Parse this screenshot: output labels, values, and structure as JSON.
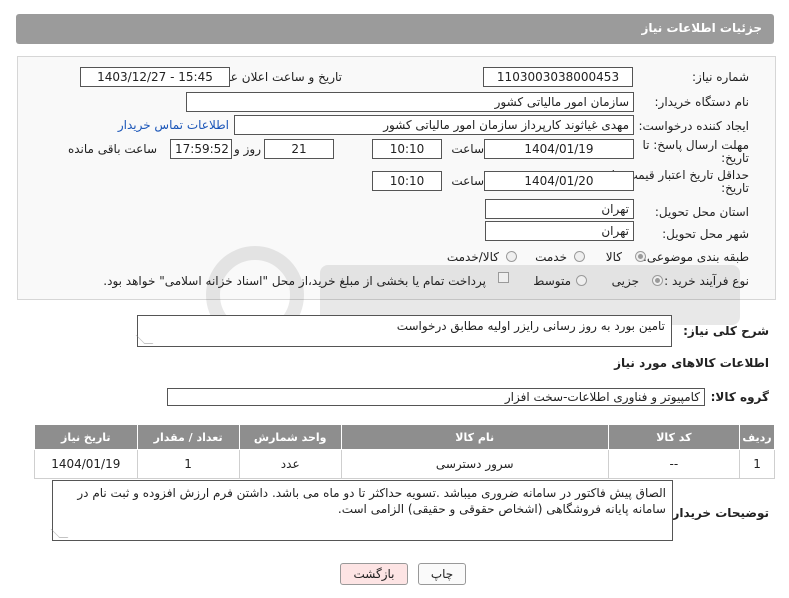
{
  "header": {
    "title": "جزئیات اطلاعات نیاز"
  },
  "form": {
    "need_number_label": "شماره نیاز:",
    "need_number": "1103003038000453",
    "announce_label": "تاریخ و ساعت اعلان عمومی:",
    "announce_value": "1403/12/27 - 15:45",
    "buyer_org_label": "نام دستگاه خریدار:",
    "buyer_org": "سازمان امور مالیاتی کشور",
    "creator_label": "ایجاد کننده درخواست:",
    "creator": "مهدی غیاثوند کارپرداز سازمان امور مالیاتی کشور",
    "contact_link": "اطلاعات تماس خریدار",
    "reply_deadline_label_1": "مهلت ارسال پاسخ: تا",
    "reply_deadline_label_2": "تاریخ:",
    "reply_date": "1404/01/19",
    "time_label": "ساعت",
    "reply_time": "10:10",
    "days_value": "21",
    "days_label": "روز و",
    "remaining_time": "17:59:52",
    "remaining_label": "ساعت باقی مانده",
    "price_validity_label_1": "حداقل تاریخ اعتبار قیمت: تا",
    "price_validity_label_2": "تاریخ:",
    "price_date": "1404/01/20",
    "price_time": "10:10",
    "province_label": "استان محل تحویل:",
    "province": "تهران",
    "city_label": "شهر محل تحویل:",
    "city": "تهران",
    "category_label": "طبقه بندی موضوعی:",
    "category_options": [
      "کالا",
      "خدمت",
      "کالا/خدمت"
    ],
    "process_label": "نوع فرآیند خرید :",
    "process_options": [
      "جزیی",
      "متوسط"
    ],
    "payment_note": "پرداخت تمام یا بخشی از مبلغ خرید،از محل \"اسناد خزانه اسلامی\" خواهد بود."
  },
  "summary": {
    "label": "شرح کلی نیاز:",
    "text": "تامین بورد به روز رسانی رایزر اولیه مطابق درخواست"
  },
  "goods_section": {
    "title": "اطلاعات کالاهای مورد نیاز",
    "group_label": "گروه کالا:",
    "group_value": "کامپیوتر و فناوری اطلاعات-سخت افزار"
  },
  "table": {
    "headers": [
      "ردیف",
      "کد کالا",
      "نام کالا",
      "واحد شمارش",
      "تعداد / مقدار",
      "تاریخ نیاز"
    ],
    "rows": [
      [
        "1",
        "--",
        "سرور دسترسی",
        "عدد",
        "1",
        "1404/01/19"
      ]
    ]
  },
  "buyer_notes": {
    "label": "توضیحات خریدار:",
    "text": "الصاق پیش فاکتور در سامانه ضروری میباشد .تسویه حداکثر تا دو ماه می باشد.  داشتن فرم ارزش افزوده و ثبت نام در سامانه پایانه فروشگاهی (اشخاص حقوقی و حقیقی) الزامی است."
  },
  "buttons": {
    "print": "چاپ",
    "back": "بازگشت"
  },
  "colors": {
    "header_bg": "#9b9b9b",
    "table_header_bg": "#8e8e8e",
    "link": "#1a55b8",
    "back_button_bg": "#fde4e4"
  }
}
